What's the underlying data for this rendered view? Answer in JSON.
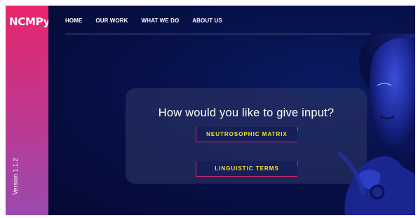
{
  "sidebar": {
    "logo": "NCMPy",
    "version": "Version 1.1.2"
  },
  "nav": {
    "items": [
      {
        "label": "HOME"
      },
      {
        "label": "OUR WORK"
      },
      {
        "label": "WHAT WE DO"
      },
      {
        "label": "ABOUT US"
      }
    ]
  },
  "main": {
    "prompt": "How would you like to give input?",
    "options": [
      {
        "label": "NEUTROSOPHIC MATRIX"
      },
      {
        "label": "LINGUISTIC TERMS"
      }
    ]
  },
  "colors": {
    "background": "#060d3d",
    "sidebar_top": "#e8266b",
    "sidebar_bottom": "#9a4ab0",
    "option_text": "#f2e430",
    "accent": "#e8266b"
  },
  "images": {
    "hero": "portrait-image"
  }
}
